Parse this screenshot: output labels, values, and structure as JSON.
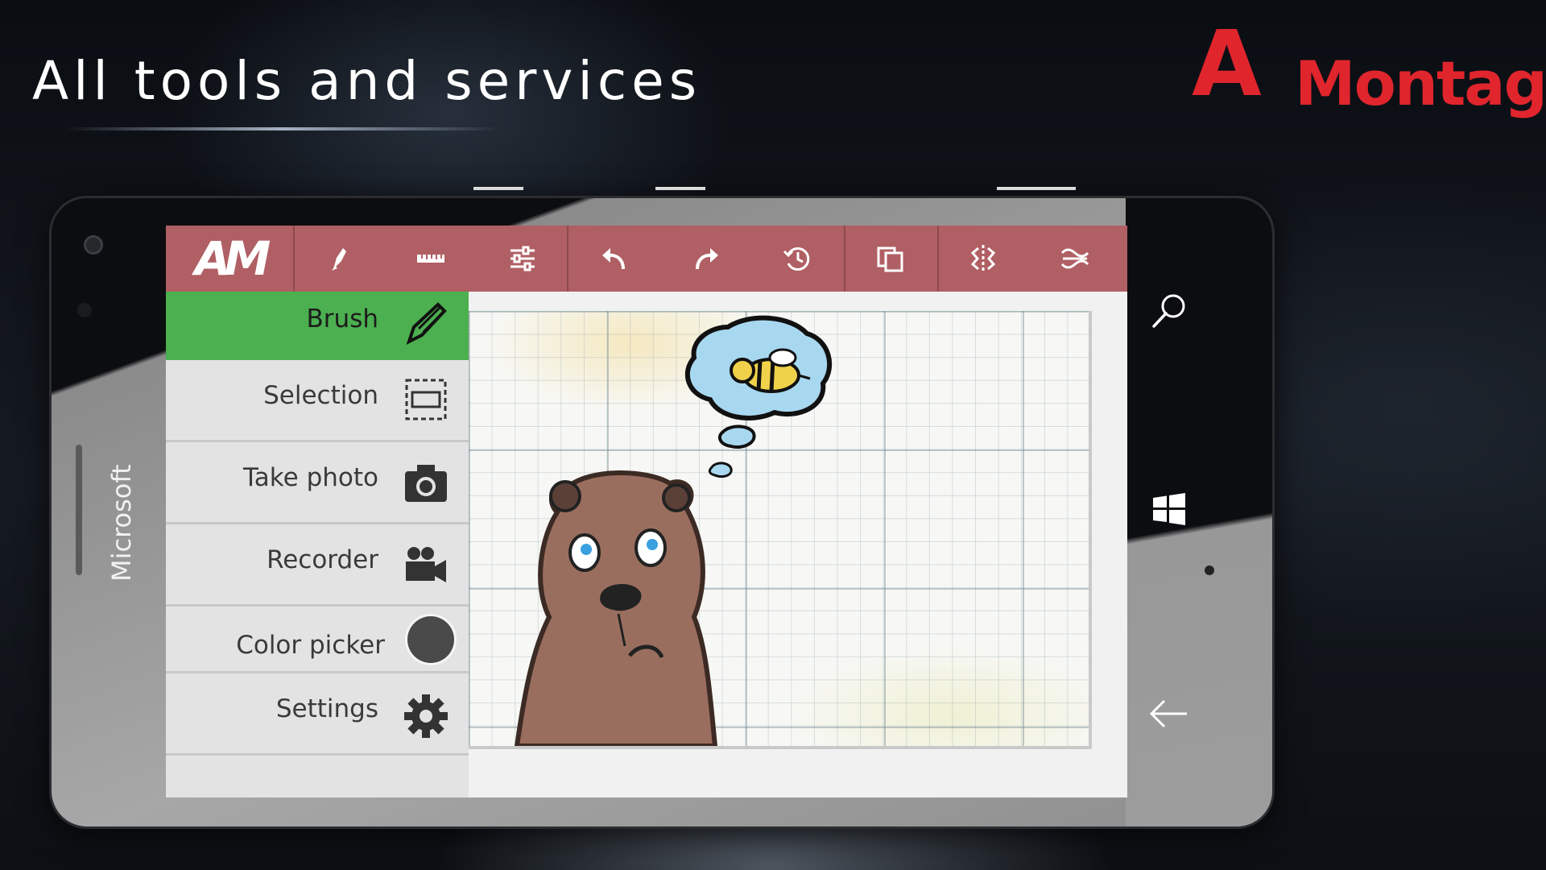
{
  "promo": {
    "headline": "All tools and services",
    "brand_logo": {
      "first_letter": "A",
      "rest": "Montage"
    },
    "colors": {
      "brand_red": "#e0252d"
    }
  },
  "phone": {
    "brand": "Microsoft",
    "hardware_buttons": {
      "search": "search-icon",
      "start": "windows-start-icon",
      "back": "back-arrow-icon"
    }
  },
  "app": {
    "logo": "AM",
    "colors": {
      "toolbar": "#b05f64",
      "active_tool": "#4caf50",
      "menu_bg": "#e3e3e3"
    },
    "toolbar": [
      {
        "name": "brush-tool-icon"
      },
      {
        "name": "ruler-icon"
      },
      {
        "name": "adjustments-sliders-icon"
      },
      {
        "name": "undo-icon"
      },
      {
        "name": "redo-icon"
      },
      {
        "name": "history-icon"
      },
      {
        "name": "layers-copy-icon"
      },
      {
        "name": "mirror-symmetry-icon"
      },
      {
        "name": "wave-distort-icon"
      }
    ],
    "menu": [
      {
        "label": "Brush",
        "icon": "brush-icon",
        "active": true
      },
      {
        "label": "Selection",
        "icon": "selection-rect-icon",
        "active": false
      },
      {
        "label": "Take photo",
        "icon": "camera-icon",
        "active": false
      },
      {
        "label": "Recorder",
        "icon": "video-recorder-icon",
        "active": false
      },
      {
        "label": "Color picker",
        "icon": "color-swatch-icon",
        "active": false
      },
      {
        "label": "Settings",
        "icon": "gear-icon",
        "active": false
      }
    ],
    "current_color": "#4a4a4a"
  }
}
